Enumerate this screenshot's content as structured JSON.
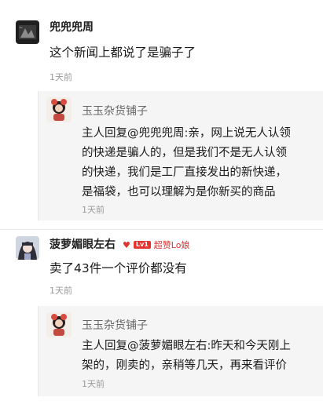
{
  "comments": [
    {
      "username": "兜兜兜周",
      "avatar_icon": "dark-avatar-icon",
      "content": "这个新闻上都说了是骗子了",
      "time": "1天前",
      "reply": {
        "name": "玉玉杂货铺子",
        "avatar_icon": "shop-avatar-icon",
        "lines": [
          "主人回复@兜兜兜周:亲，网上说无人认领",
          "的快递是骗人的，但是我们不是无人认领",
          "的快递，我们是工厂直接发出的新快递，",
          "是福袋，也可以理解为是你新买的商品"
        ],
        "time": "1天前"
      }
    },
    {
      "username": "菠萝媚眼左右",
      "avatar_icon": "girl-avatar-icon",
      "heart_icon": "heart-icon",
      "level": "Lv1",
      "fan_title": "超赞Lo娘",
      "content": "卖了43件一个评价都没有",
      "time": "1天前",
      "reply": {
        "name": "玉玉杂货铺子",
        "avatar_icon": "shop-avatar-icon",
        "lines": [
          "主人回复@菠萝媚眼左右:昨天和今天刚上",
          "架的，刚卖的，亲稍等几天，再来看评价"
        ],
        "time": "1天前"
      }
    }
  ],
  "colors": {
    "reply_background": "#f5f5f5",
    "time_text": "#9a9a9a",
    "accent_red": "#e0322f"
  }
}
